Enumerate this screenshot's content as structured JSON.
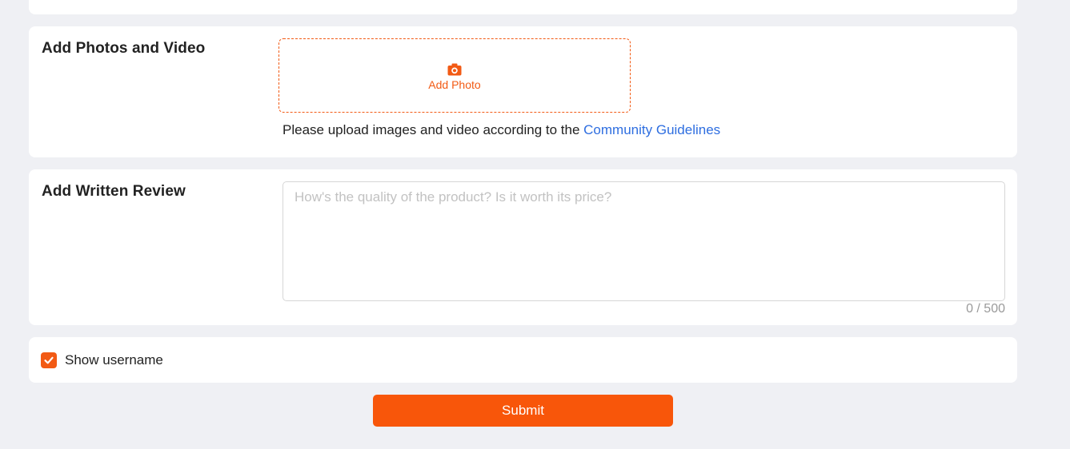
{
  "photos_section": {
    "title": "Add Photos and Video",
    "upload_label": "Add Photo",
    "upload_icon": "camera-icon",
    "guidelines_prefix": "Please upload images and video according to the ",
    "guidelines_link": "Community Guidelines"
  },
  "review_section": {
    "title": "Add Written Review",
    "placeholder": "How's the quality of the product? Is it worth its price?",
    "value": "",
    "char_counter": "0 / 500"
  },
  "options": {
    "show_username_label": "Show username",
    "show_username_checked": true
  },
  "submit": {
    "label": "Submit"
  },
  "colors": {
    "accent": "#f8560a",
    "link": "#2e6ee0",
    "background": "#eff0f4"
  }
}
